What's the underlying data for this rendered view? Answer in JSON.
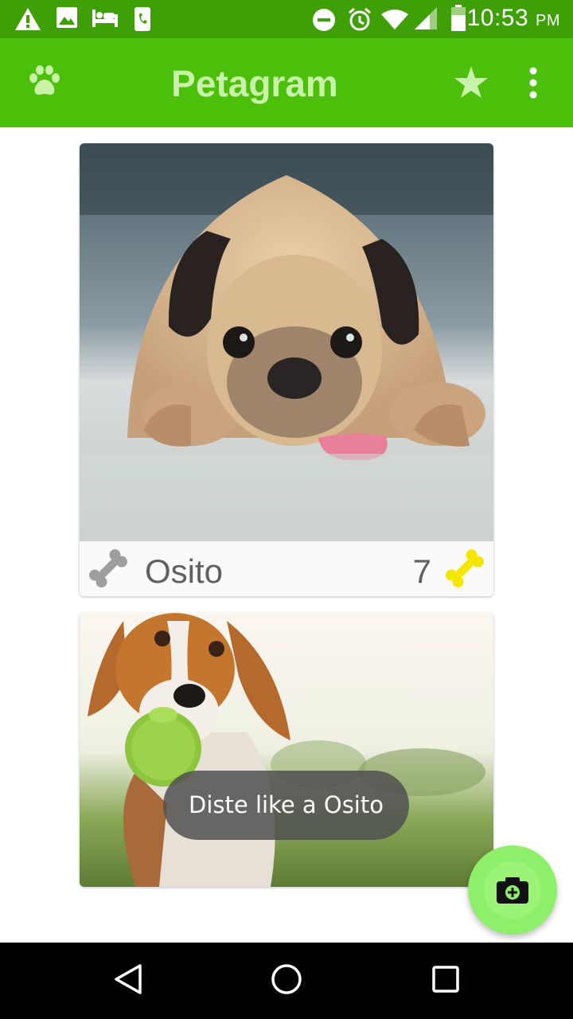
{
  "status_bar": {
    "time": "10:53",
    "ampm": "PM",
    "icons": [
      "warning-icon",
      "image-icon",
      "hotel-icon",
      "phone-icon",
      "do-not-disturb-icon",
      "alarm-icon",
      "wifi-icon",
      "signal-icon",
      "battery-icon"
    ]
  },
  "app_bar": {
    "title": "Petagram",
    "left_icon": "paw-icon",
    "actions": [
      "star-icon",
      "more-vert-icon"
    ]
  },
  "pets": [
    {
      "name": "Osito",
      "likes": "7",
      "photo": "pug lying on floor"
    },
    {
      "name": "",
      "likes": "",
      "photo": "beagle with green ball"
    }
  ],
  "toast": {
    "message": "Diste like a Osito"
  },
  "fab": {
    "icon": "add-a-photo-icon"
  },
  "nav_bar": {
    "buttons": [
      "back-triangle-icon",
      "home-circle-icon",
      "recents-square-icon"
    ]
  },
  "colors": {
    "status_bar": "#3f9f07",
    "app_bar": "#4cbf0b",
    "title_text": "#c8f2a8",
    "bone_liked": "#f5e600",
    "bone_unliked": "#9e9e9e",
    "fab": "#8ef06a"
  }
}
